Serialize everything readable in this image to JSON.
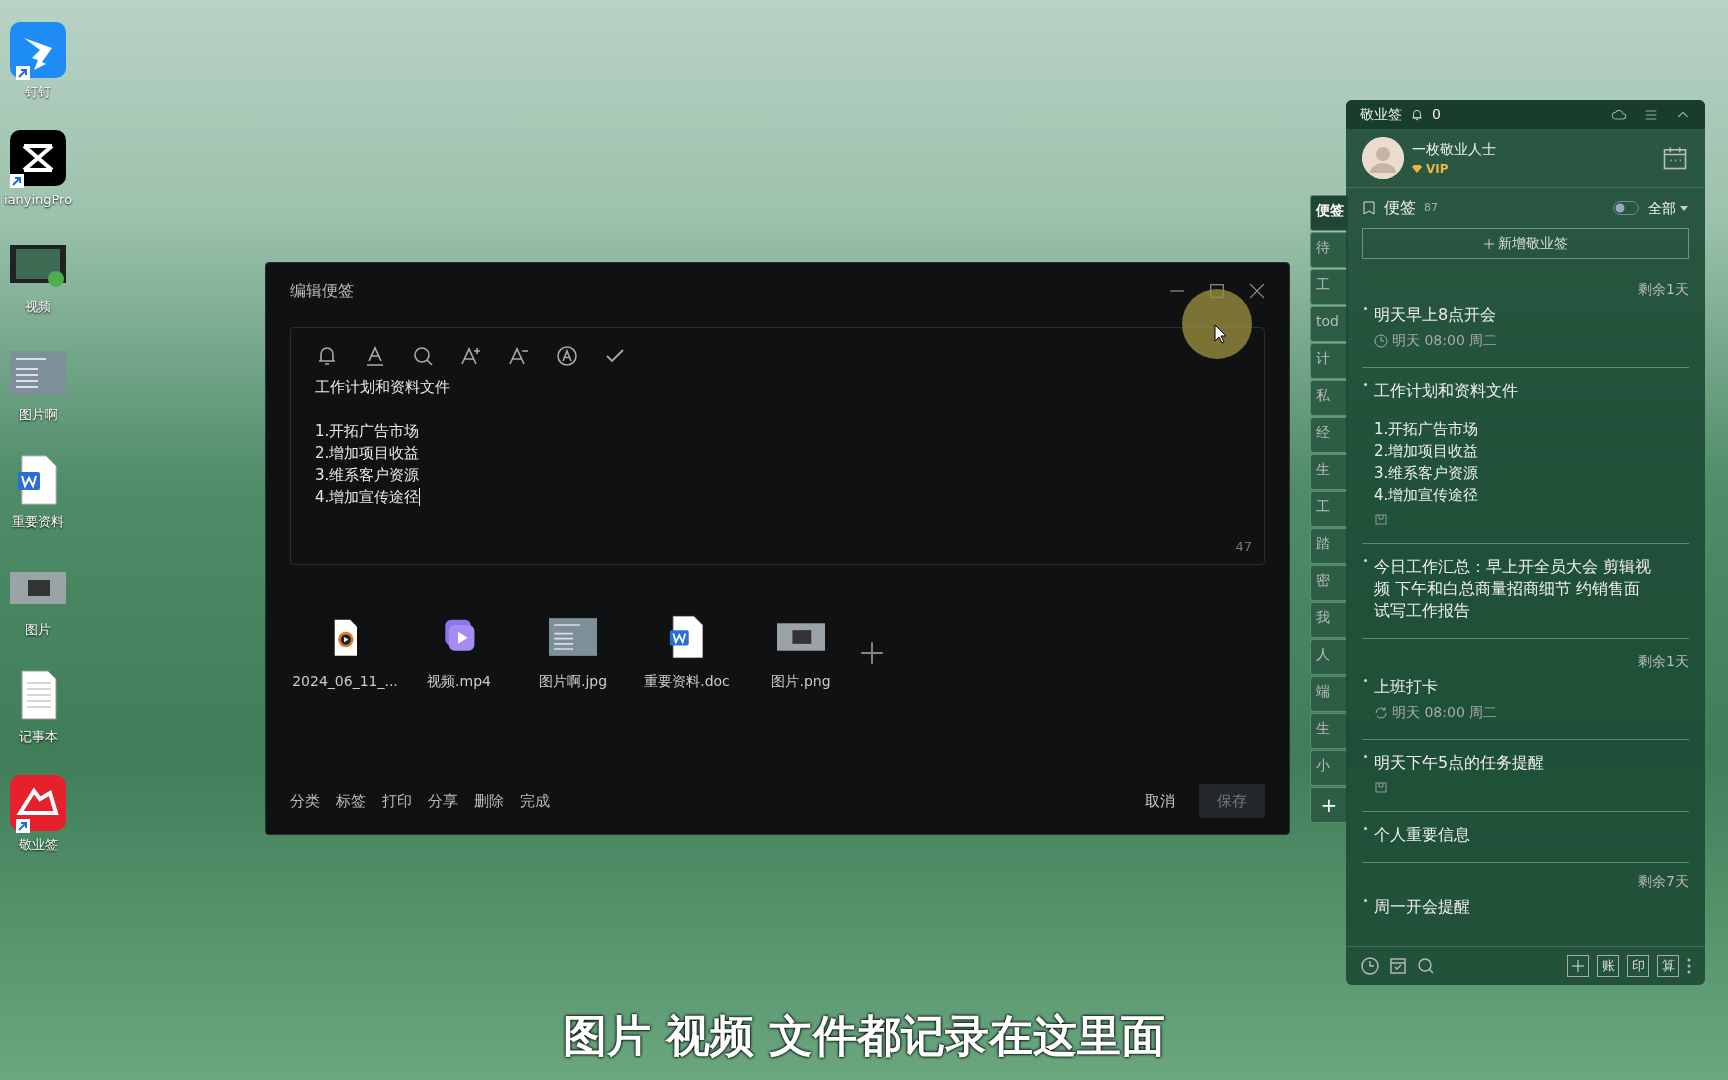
{
  "desktop": {
    "icons": [
      {
        "label": "钉钉",
        "kind": "wing",
        "shortcut": true
      },
      {
        "label": "ianyingPro",
        "kind": "clapper",
        "shortcut": true
      },
      {
        "label": "视频",
        "kind": "film",
        "shortcut": false
      },
      {
        "label": "图片啊",
        "kind": "doc-thumb",
        "shortcut": false
      },
      {
        "label": "重要资料",
        "kind": "word",
        "shortcut": false
      },
      {
        "label": "图片",
        "kind": "photo",
        "shortcut": false
      },
      {
        "label": "记事本",
        "kind": "text",
        "shortcut": false
      },
      {
        "label": "敬业签",
        "kind": "note-app",
        "shortcut": true
      }
    ]
  },
  "editor": {
    "title": "编辑便签",
    "tools": [
      {
        "kind": "bell"
      },
      {
        "kind": "font-color"
      },
      {
        "kind": "search"
      },
      {
        "kind": "font-up"
      },
      {
        "kind": "font-down"
      },
      {
        "kind": "circle-a"
      },
      {
        "kind": "check"
      }
    ],
    "heading": "工作计划和资料文件",
    "lines": [
      "1.开拓广告市场",
      "2.增加项目收益",
      "3.维系客户资源",
      "4.增加宣传途径"
    ],
    "char_count": "47",
    "attachments": [
      {
        "name": "2024_06_11_...",
        "kind": "video-file"
      },
      {
        "name": "视频.mp4",
        "kind": "video"
      },
      {
        "name": "图片啊.jpg",
        "kind": "doc-thumb"
      },
      {
        "name": "重要资料.doc",
        "kind": "word"
      },
      {
        "name": "图片.png",
        "kind": "photo"
      }
    ],
    "actions": [
      "分类",
      "标签",
      "打印",
      "分享",
      "删除",
      "完成"
    ],
    "cancel": "取消",
    "save": "保存"
  },
  "widget": {
    "app_name": "敬业签",
    "bell_count": "0",
    "user": {
      "name": "一枚敬业人士",
      "badge": "VIP"
    },
    "section": {
      "label": "便签",
      "count": "87",
      "filter": "全部",
      "toggle_on": false
    },
    "new_button": "新增敬业签",
    "side_tabs": [
      {
        "label": "便签",
        "selected": true
      },
      {
        "label": "待",
        "selected": false
      },
      {
        "label": "工",
        "selected": false
      },
      {
        "label": "tod",
        "selected": false
      },
      {
        "label": "计",
        "selected": false
      },
      {
        "label": "私",
        "selected": false
      },
      {
        "label": "经",
        "selected": false
      },
      {
        "label": "生",
        "selected": false
      },
      {
        "label": "工",
        "selected": false
      },
      {
        "label": "踏",
        "selected": false
      },
      {
        "label": "密",
        "selected": false
      },
      {
        "label": "我",
        "selected": false
      },
      {
        "label": "人",
        "selected": false
      },
      {
        "label": "端",
        "selected": false
      },
      {
        "label": "生",
        "selected": false
      },
      {
        "label": "小",
        "selected": false
      }
    ],
    "add_tab": "+",
    "notes": [
      {
        "remaining": "剩余1天",
        "title": "明天早上8点开会",
        "reminder": {
          "kind": "clock",
          "time": "明天 08:00 周二"
        },
        "attachment": false
      },
      {
        "title": "工作计划和资料文件",
        "lines": [
          "1.开拓广告市场",
          "2.增加项目收益",
          "3.维系客户资源",
          "4.增加宣传途径"
        ],
        "attachment": true
      },
      {
        "title": "今日工作汇总：早上开全员大会 剪辑视频 下午和白总商量招商细节 约销售面试写工作报告",
        "attachment": false
      },
      {
        "remaining": "剩余1天",
        "title": "上班打卡",
        "reminder": {
          "kind": "repeat",
          "time": "明天 08:00 周二"
        },
        "attachment": false
      },
      {
        "title": "明天下午5点的任务提醒",
        "attachment": true
      },
      {
        "title": "个人重要信息",
        "attachment": false
      },
      {
        "remaining": "剩余7天",
        "title": "周一开会提醒",
        "attachment": false
      }
    ],
    "bottom_keys": [
      "账",
      "印",
      "算"
    ]
  },
  "caption": "图片 视频 文件都记录在这里面"
}
